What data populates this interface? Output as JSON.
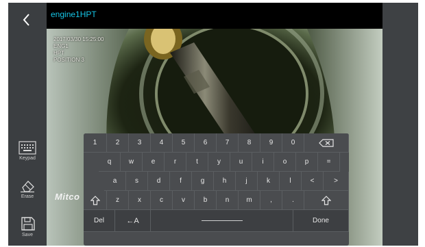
{
  "header": {
    "title": "engine1HPT"
  },
  "overlay_lines": [
    "2017/03/30 15:25:00",
    "ENG1",
    "HPT",
    "POSITION 3"
  ],
  "logo_text": "Mitco",
  "sidebar": [
    {
      "label": "Keypad",
      "icon": "keypad-icon"
    },
    {
      "label": "Erase",
      "icon": "eraser-icon"
    },
    {
      "label": "Save",
      "icon": "floppy-disk-icon"
    }
  ],
  "keyboard": {
    "row1": [
      "1",
      "2",
      "3",
      "4",
      "5",
      "6",
      "7",
      "8",
      "9",
      "0"
    ],
    "row2": [
      "q",
      "w",
      "e",
      "r",
      "t",
      "y",
      "u",
      "i",
      "o",
      "p",
      "="
    ],
    "row3": [
      "a",
      "s",
      "d",
      "f",
      "g",
      "h",
      "j",
      "k",
      "l",
      "<",
      ">"
    ],
    "row4": [
      "z",
      "x",
      "c",
      "v",
      "b",
      "n",
      "m",
      ",",
      "."
    ],
    "del_label": "Del",
    "case_label": "←A",
    "done_label": "Done"
  },
  "colors": {
    "title": "#16c7e8",
    "rail": "#3b3e41",
    "keyboard": "#4a4c4f"
  }
}
